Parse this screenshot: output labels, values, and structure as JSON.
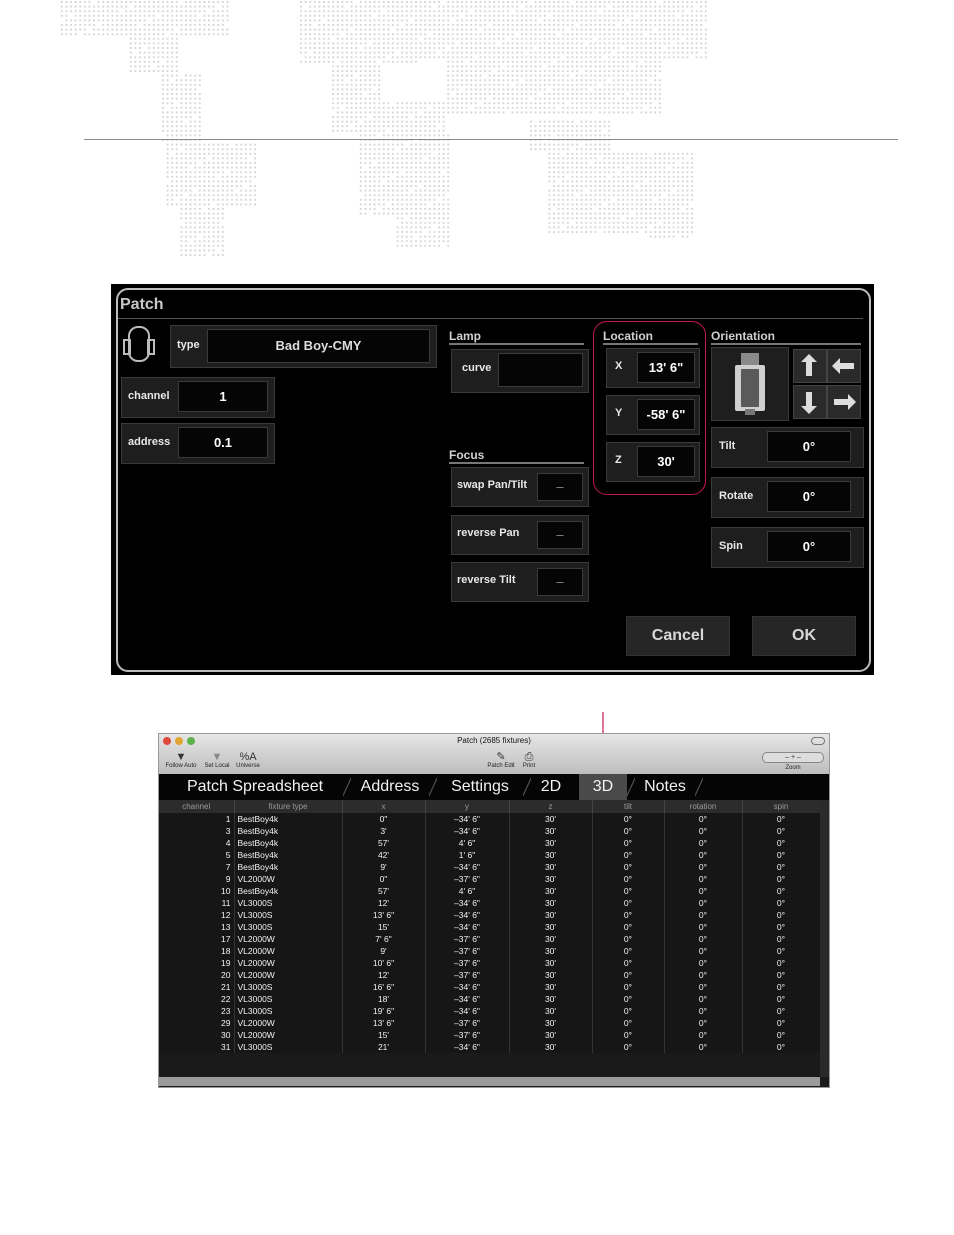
{
  "dialog": {
    "title": "Patch",
    "type_label": "type",
    "type_value": "Bad Boy-CMY",
    "channel_label": "channel",
    "channel_value": "1",
    "address_label": "address",
    "address_value": "0.1",
    "lamp_header": "Lamp",
    "curve_label": "curve",
    "curve_value": "",
    "focus_header": "Focus",
    "swap_label": "swap Pan/Tilt",
    "swap_value": "–",
    "reverse_pan_label": "reverse Pan",
    "reverse_pan_value": "–",
    "reverse_tilt_label": "reverse Tilt",
    "reverse_tilt_value": "–",
    "location_header": "Location",
    "x_label": "X",
    "x_value": "13' 6\"",
    "y_label": "Y",
    "y_value": "-58' 6\"",
    "z_label": "Z",
    "z_value": "30'",
    "orientation_header": "Orientation",
    "tilt_label": "Tilt",
    "tilt_value": "0°",
    "rotate_label": "Rotate",
    "rotate_value": "0°",
    "spin_label": "Spin",
    "spin_value": "0°",
    "cancel_label": "Cancel",
    "ok_label": "OK",
    "highlight_color": "#c2185b"
  },
  "spreadsheet": {
    "window_title": "Patch (2685 fixtures)",
    "toolbar": {
      "follow_auto": "Follow Auto",
      "set_local": "Set Local",
      "universe": "Universe",
      "patch_edit": "Patch Edit",
      "print": "Print",
      "zoom": "Zoom",
      "zoom_controls": "–   +   –"
    },
    "tabs": [
      "Patch Spreadsheet",
      "Address",
      "Settings",
      "2D",
      "3D",
      "Notes"
    ],
    "active_tab": "3D",
    "columns": [
      "channel",
      "fixture type",
      "x",
      "y",
      "z",
      "tilt",
      "rotation",
      "spin"
    ],
    "rows": [
      [
        "1",
        "BestBoy4k",
        "0\"",
        "–34' 6\"",
        "30'",
        "0°",
        "0°",
        "0°"
      ],
      [
        "3",
        "BestBoy4k",
        "3'",
        "–34' 6\"",
        "30'",
        "0°",
        "0°",
        "0°"
      ],
      [
        "4",
        "BestBoy4k",
        "57'",
        "4' 6\"",
        "30'",
        "0°",
        "0°",
        "0°"
      ],
      [
        "5",
        "BestBoy4k",
        "42'",
        "1' 6\"",
        "30'",
        "0°",
        "0°",
        "0°"
      ],
      [
        "7",
        "BestBoy4k",
        "9'",
        "–34' 6\"",
        "30'",
        "0°",
        "0°",
        "0°"
      ],
      [
        "9",
        "VL2000W",
        "0\"",
        "–37' 6\"",
        "30'",
        "0°",
        "0°",
        "0°"
      ],
      [
        "10",
        "BestBoy4k",
        "57'",
        "4' 6\"",
        "30'",
        "0°",
        "0°",
        "0°"
      ],
      [
        "11",
        "VL3000S",
        "12'",
        "–34' 6\"",
        "30'",
        "0°",
        "0°",
        "0°"
      ],
      [
        "12",
        "VL3000S",
        "13' 6\"",
        "–34' 6\"",
        "30'",
        "0°",
        "0°",
        "0°"
      ],
      [
        "13",
        "VL3000S",
        "15'",
        "–34' 6\"",
        "30'",
        "0°",
        "0°",
        "0°"
      ],
      [
        "17",
        "VL2000W",
        "7' 6\"",
        "–37' 6\"",
        "30'",
        "0°",
        "0°",
        "0°"
      ],
      [
        "18",
        "VL2000W",
        "9'",
        "–37' 6\"",
        "30'",
        "0°",
        "0°",
        "0°"
      ],
      [
        "19",
        "VL2000W",
        "10' 6\"",
        "–37' 6\"",
        "30'",
        "0°",
        "0°",
        "0°"
      ],
      [
        "20",
        "VL2000W",
        "12'",
        "–37' 6\"",
        "30'",
        "0°",
        "0°",
        "0°"
      ],
      [
        "21",
        "VL3000S",
        "16' 6\"",
        "–34' 6\"",
        "30'",
        "0°",
        "0°",
        "0°"
      ],
      [
        "22",
        "VL3000S",
        "18'",
        "–34' 6\"",
        "30'",
        "0°",
        "0°",
        "0°"
      ],
      [
        "23",
        "VL3000S",
        "19' 6\"",
        "–34' 6\"",
        "30'",
        "0°",
        "0°",
        "0°"
      ],
      [
        "29",
        "VL2000W",
        "13' 6\"",
        "–37' 6\"",
        "30'",
        "0°",
        "0°",
        "0°"
      ],
      [
        "30",
        "VL2000W",
        "15'",
        "–37' 6\"",
        "30'",
        "0°",
        "0°",
        "0°"
      ],
      [
        "31",
        "VL3000S",
        "21'",
        "–34' 6\"",
        "30'",
        "0°",
        "0°",
        "0°"
      ]
    ]
  },
  "colors": {
    "arrow": "#c2185b"
  }
}
